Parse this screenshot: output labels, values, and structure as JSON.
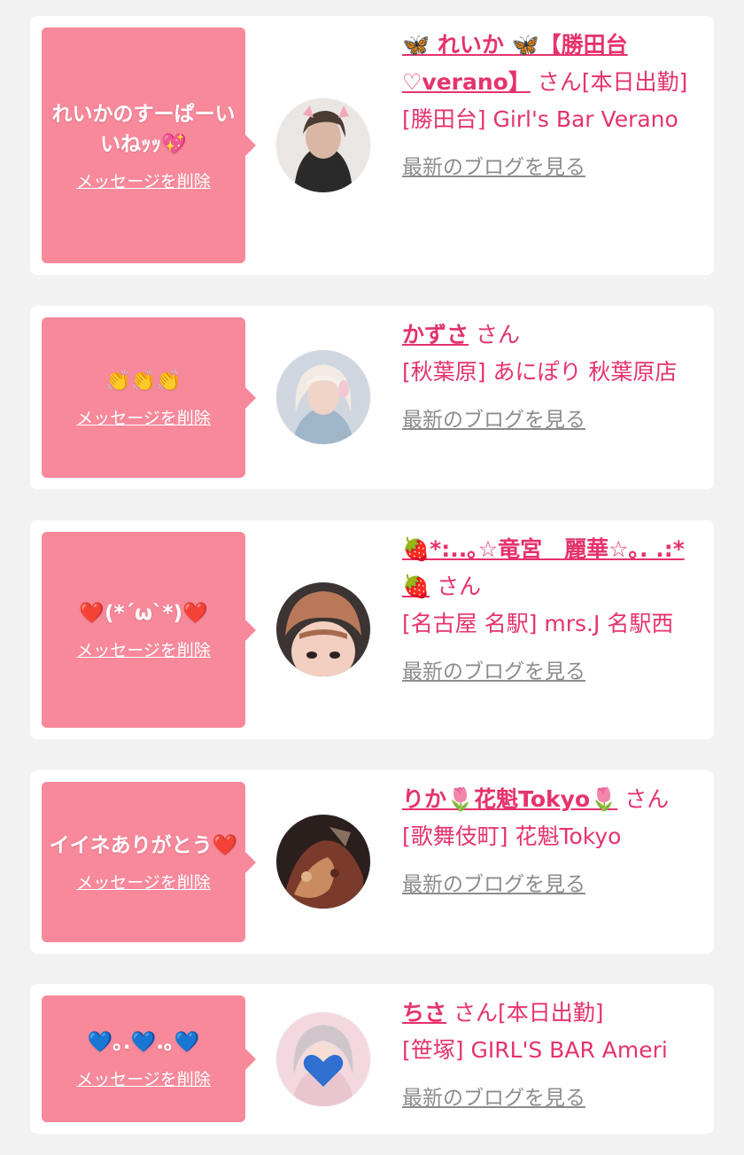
{
  "delete_label": "メッセージを削除",
  "blog_label": "最新のブログを見る",
  "colors": {
    "accent": "#e5336b",
    "bubble": "#f7899b",
    "card": "#ffffff",
    "background": "#f2f2f2",
    "link_gray": "#8c8c8c"
  },
  "cards": [
    {
      "message": "れいかのすーぱーいいねｯｯ💖",
      "name": "🦋 れいか 🦋【勝田台♡verano】",
      "suffix": "さん[本日出勤]",
      "shop": "[勝田台] Girl's Bar Verano",
      "avatar": "avatar-photo"
    },
    {
      "message": "👏👏👏",
      "name": "かずさ",
      "suffix": "さん",
      "shop": "[秋葉原] あにぽり 秋葉原店",
      "avatar": "avatar-photo"
    },
    {
      "message": "❤️(*´ω`*)❤️",
      "name": "🍓*:..｡☆竜宮　麗華☆｡. .:*🍓",
      "suffix": "さん",
      "shop": "[名古屋 名駅] mrs.J 名駅西",
      "avatar": "avatar-photo"
    },
    {
      "message": "イイネありがとう❤️",
      "name": "りか🌷花魁Tokyo🌷",
      "suffix": "さん",
      "shop": "[歌舞伎町] 花魁Tokyo",
      "avatar": "avatar-photo"
    },
    {
      "message": "💙｡.💙.｡💙",
      "name": "ちさ",
      "suffix": "さん[本日出勤]",
      "shop": "[笹塚] GIRL'S BAR Ameri",
      "avatar": "avatar-photo"
    }
  ]
}
